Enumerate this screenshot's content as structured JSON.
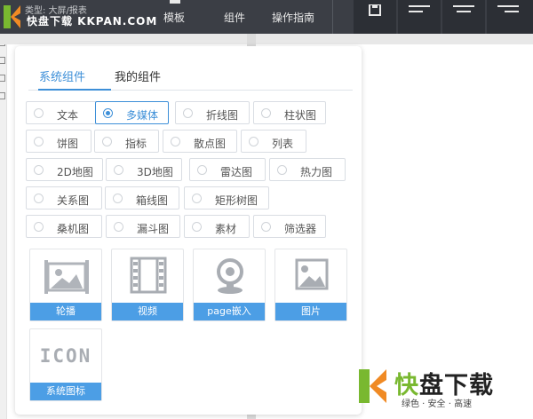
{
  "watermark_top": {
    "breadcrumb": "类型: 大屏/报表",
    "brand": "快盘下载 KKPAN.COM"
  },
  "header": {
    "nav": [
      {
        "label": "模板"
      },
      {
        "label": "组件"
      },
      {
        "label": "操作指南"
      }
    ],
    "tools": [
      "save-icon",
      "align-left-icon",
      "align-center-icon",
      "align-right-icon"
    ]
  },
  "panel": {
    "tabs": [
      {
        "label": "系统组件",
        "active": true
      },
      {
        "label": "我的组件",
        "active": false
      }
    ],
    "chips": [
      {
        "label": "文本",
        "selected": false
      },
      {
        "label": "多媒体",
        "selected": true
      },
      {
        "label": "折线图",
        "selected": false
      },
      {
        "label": "柱状图",
        "selected": false
      },
      {
        "label": "饼图",
        "selected": false
      },
      {
        "label": "指标",
        "selected": false
      },
      {
        "label": "散点图",
        "selected": false
      },
      {
        "label": "列表",
        "selected": false
      },
      {
        "label": "2D地图",
        "selected": false
      },
      {
        "label": "3D地图",
        "selected": false
      },
      {
        "label": "雷达图",
        "selected": false
      },
      {
        "label": "热力图",
        "selected": false
      },
      {
        "label": "关系图",
        "selected": false
      },
      {
        "label": "箱线图",
        "selected": false
      },
      {
        "label": "矩形树图",
        "selected": false
      },
      {
        "label": "桑机图",
        "selected": false
      },
      {
        "label": "漏斗图",
        "selected": false
      },
      {
        "label": "素材",
        "selected": false
      },
      {
        "label": "筛选器",
        "selected": false
      }
    ],
    "cards": [
      {
        "label": "轮播",
        "icon": "carousel-icon"
      },
      {
        "label": "视频",
        "icon": "video-film-icon"
      },
      {
        "label": "page嵌入",
        "icon": "webcam-embed-icon"
      },
      {
        "label": "图片",
        "icon": "image-icon"
      },
      {
        "label": "系统图标",
        "icon": "system-icon-icon",
        "icon_text": "ICON"
      }
    ]
  },
  "watermark_bottom": {
    "big_prefix": "快",
    "big_rest": "盘下载",
    "slogan": "绿色 · 安全 · 高速"
  },
  "colors": {
    "accent": "#3d8fd8",
    "card_caption": "#4c9ee5",
    "topbar": "#3b3e45",
    "watermark_green": "#79b830",
    "watermark_orange": "#f08a24"
  }
}
